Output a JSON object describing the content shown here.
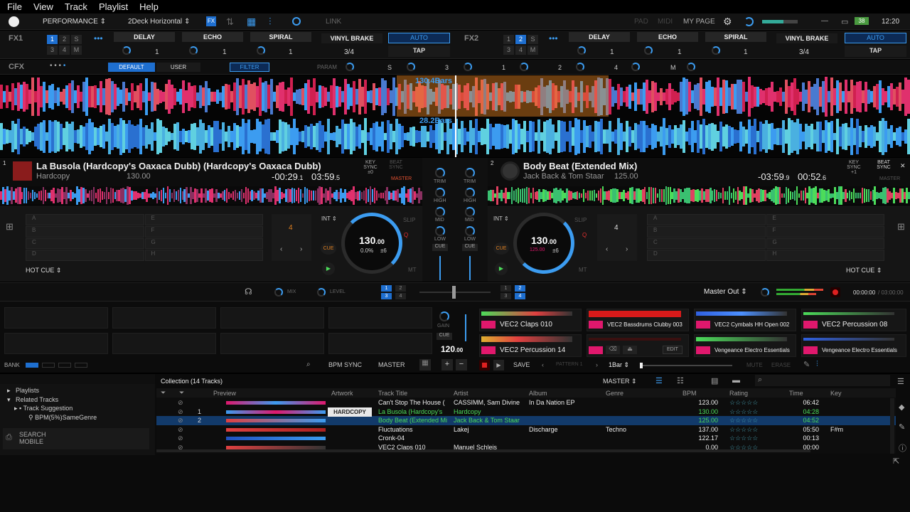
{
  "menu": [
    "File",
    "View",
    "Track",
    "Playlist",
    "Help"
  ],
  "toolbar": {
    "mode": "PERFORMANCE",
    "layout": "2Deck Horizontal",
    "link": "LINK",
    "pad": "PAD",
    "midi": "MIDI",
    "mypage": "MY PAGE",
    "battery": "38",
    "clock": "12:20"
  },
  "fx1": {
    "label": "FX1",
    "nums": [
      "1",
      "2",
      "S",
      "3",
      "4",
      "M"
    ],
    "slots": [
      {
        "name": "DELAY",
        "value": "1"
      },
      {
        "name": "ECHO",
        "value": "1"
      },
      {
        "name": "SPIRAL",
        "value": "1"
      }
    ],
    "beat_name": "VINYL BRAKE",
    "beat_value": "3/4",
    "auto": "AUTO",
    "tap": "TAP"
  },
  "fx2": {
    "label": "FX2",
    "nums": [
      "1",
      "2",
      "S",
      "3",
      "4",
      "M"
    ],
    "slots": [
      {
        "name": "DELAY",
        "value": "1"
      },
      {
        "name": "ECHO",
        "value": "1"
      },
      {
        "name": "SPIRAL",
        "value": "1"
      }
    ],
    "beat_name": "VINYL BRAKE",
    "beat_value": "3/4",
    "auto": "AUTO",
    "tap": "TAP"
  },
  "cfx": {
    "label": "CFX",
    "default": "DEFAULT",
    "user": "USER",
    "filter": "FILTER",
    "param": "PARAM",
    "labels": [
      "S",
      "3",
      "1",
      "2",
      "4",
      "M"
    ]
  },
  "waveform": {
    "bars_top": "130.4Bars",
    "bars_bottom": "28.2Bars"
  },
  "deck1": {
    "num": "1",
    "title": "La Busola (Hardcopy's Oaxaca Dubb) (Hardcopy's Oaxaca Dubb)",
    "artist": "Hardcopy",
    "bpm_small": "130.00",
    "remain_main": "-00:29",
    "remain_frac": ".1",
    "total_main": "03:59",
    "total_frac": ".5",
    "key_sync": "KEY SYNC",
    "key_offset": "±0",
    "beat_sync": "BEAT SYNC",
    "master": "MASTER",
    "pads_left": [
      "A",
      "B",
      "C",
      "D"
    ],
    "pads_right": [
      "E",
      "F",
      "G",
      "H"
    ],
    "loop_beats": "4",
    "int": "INT",
    "slip": "SLIP",
    "cue": "CUE",
    "mt": "MT",
    "bpm": "130",
    "bpm_dec": ".00",
    "pitch": "0.0%",
    "range": "±6",
    "hotcue": "HOT CUE"
  },
  "deck2": {
    "num": "2",
    "title": "Body Beat (Extended Mix)",
    "artist": "Jack Back & Tom Staar",
    "bpm_small": "125.00",
    "remain_main": "-03:59",
    "remain_frac": ".9",
    "total_main": "00:52",
    "total_frac": ".6",
    "key_sync": "KEY SYNC",
    "key_offset": "+1",
    "beat_sync": "BEAT SYNC",
    "master": "MASTER",
    "pads_left": [
      "A",
      "B",
      "C",
      "D"
    ],
    "pads_right": [
      "E",
      "F",
      "G",
      "H"
    ],
    "loop_beats": "4",
    "int": "INT",
    "slip": "SLIP",
    "cue": "CUE",
    "mt": "MT",
    "bpm": "130",
    "bpm_dec": ".00",
    "pitch": "125.00",
    "range": "±6",
    "hotcue": "HOT CUE"
  },
  "mixer": {
    "trim": "TRIM",
    "high": "HIGH",
    "mid": "MID",
    "low": "LOW",
    "cue": "CUE"
  },
  "midbar": {
    "mix": "MIX",
    "level": "LEVEL",
    "left_nums": [
      "1",
      "2",
      "3",
      "4"
    ],
    "right_nums": [
      "1",
      "2",
      "3",
      "4"
    ],
    "master_out": "Master Out",
    "rec_time": "00:00:00",
    "rec_total": "/ 03:00:00"
  },
  "sampler": {
    "gain": "GAIN",
    "cue": "CUE",
    "bpm": "120",
    "bpm_dec": ".00",
    "slots": [
      {
        "name": "VEC2 Claps 010"
      },
      {
        "name": "VEC2 Bassdrums Clubby 003"
      },
      {
        "name": "VEC2 Cymbals HH Open 002"
      },
      {
        "name": "VEC2 Percussion 08"
      },
      {
        "name": "VEC2 Percussion 14"
      },
      {
        "name": "EDIT"
      },
      {
        "name": "Vengeance Electro Essentials"
      },
      {
        "name": "Vengeance Electro Essentials"
      }
    ],
    "bank": "BANK",
    "bpm_sync": "BPM SYNC",
    "master": "MASTER",
    "save": "SAVE",
    "pattern": "PATTERN 1",
    "bar": "1Bar",
    "mute": "MUTE",
    "erase": "ERASE"
  },
  "browser": {
    "collection": "Collection (14 Tracks)",
    "master": "MASTER",
    "tree": [
      "Playlists",
      "Related Tracks",
      "Track Suggestion",
      "BPM(5%)SameGenre"
    ],
    "search_mobile": "SEARCH MOBILE",
    "columns": [
      "Preview",
      "Artwork",
      "Track Title",
      "Artist",
      "Album",
      "Genre",
      "BPM",
      "Rating",
      "Time",
      "Key"
    ],
    "rows": [
      {
        "deck": "",
        "title": "Can't Stop The House (",
        "artist": "CASSIMM, Sam Divine",
        "album": "In Da Nation EP",
        "genre": "",
        "bpm": "123.00",
        "time": "06:42",
        "key": ""
      },
      {
        "deck": "1",
        "title": "La Busola (Hardcopy's",
        "artist": "Hardcopy",
        "album": "",
        "genre": "",
        "bpm": "130.00",
        "time": "04:28",
        "key": ""
      },
      {
        "deck": "2",
        "title": "Body Beat (Extended Mi",
        "artist": "Jack Back & Tom Staar",
        "album": "",
        "genre": "",
        "bpm": "125.00",
        "time": "04:52",
        "key": ""
      },
      {
        "deck": "",
        "title": "Fluctuations",
        "artist": "Lakej",
        "album": "Discharge",
        "genre": "Techno",
        "bpm": "137.00",
        "time": "05:50",
        "key": "F#m"
      },
      {
        "deck": "",
        "title": "Cronk-04",
        "artist": "",
        "album": "",
        "genre": "",
        "bpm": "122.17",
        "time": "00:13",
        "key": ""
      },
      {
        "deck": "",
        "title": "VEC2 Claps 010",
        "artist": "Manuel Schleis",
        "album": "",
        "genre": "",
        "bpm": "0.00",
        "time": "00:00",
        "key": ""
      }
    ],
    "artwork_text": "HARDCOPY"
  },
  "colors": {
    "accent": "#3c9cf0",
    "pink": "#e0186d",
    "orange": "#e08020",
    "green": "#4cdc5a"
  }
}
